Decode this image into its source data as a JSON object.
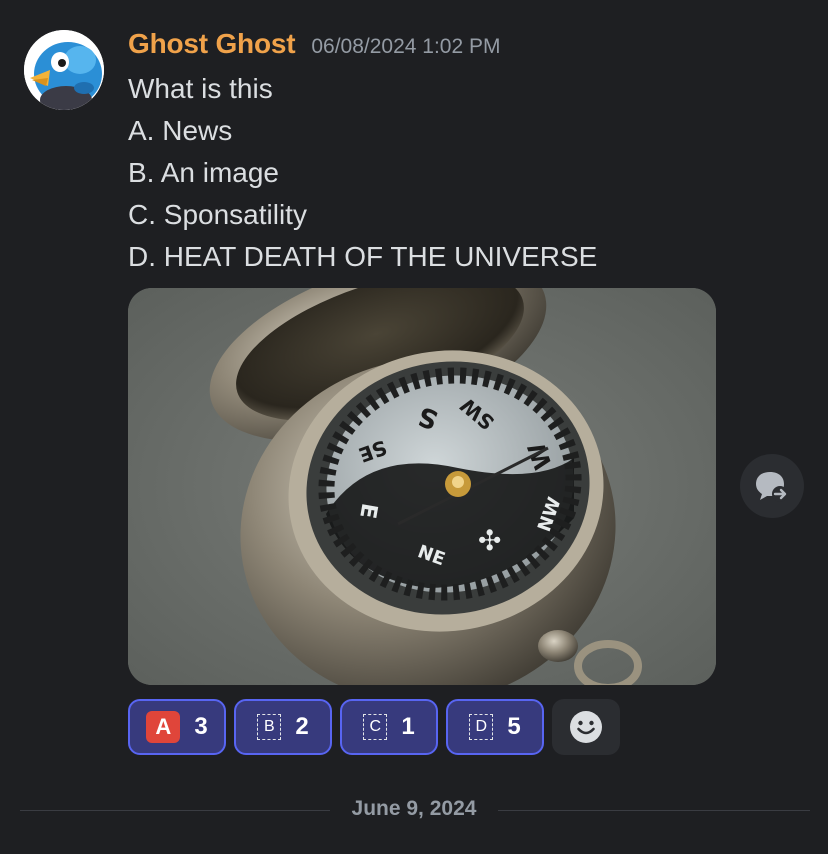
{
  "message": {
    "username": "Ghost Ghost",
    "timestamp": "06/08/2024 1:02 PM",
    "lines": [
      "What is this",
      "A. News",
      "B. An image",
      "C. Sponsatility",
      "D. HEAT DEATH OF THE UNIVERSE"
    ],
    "attachment_icon": "compass-photo"
  },
  "reactions": [
    {
      "emoji": "A",
      "count": "3"
    },
    {
      "emoji": "B",
      "count": "2"
    },
    {
      "emoji": "C",
      "count": "1"
    },
    {
      "emoji": "D",
      "count": "5"
    }
  ],
  "icons": {
    "add_reaction": "smiley-icon",
    "side_action": "forward-thread-icon"
  },
  "date_divider": "June 9, 2024",
  "colors": {
    "background": "#1e1f22",
    "username": "#f0a24a",
    "reaction_border": "#5865f2",
    "reaction_bg": "#373a7d"
  }
}
